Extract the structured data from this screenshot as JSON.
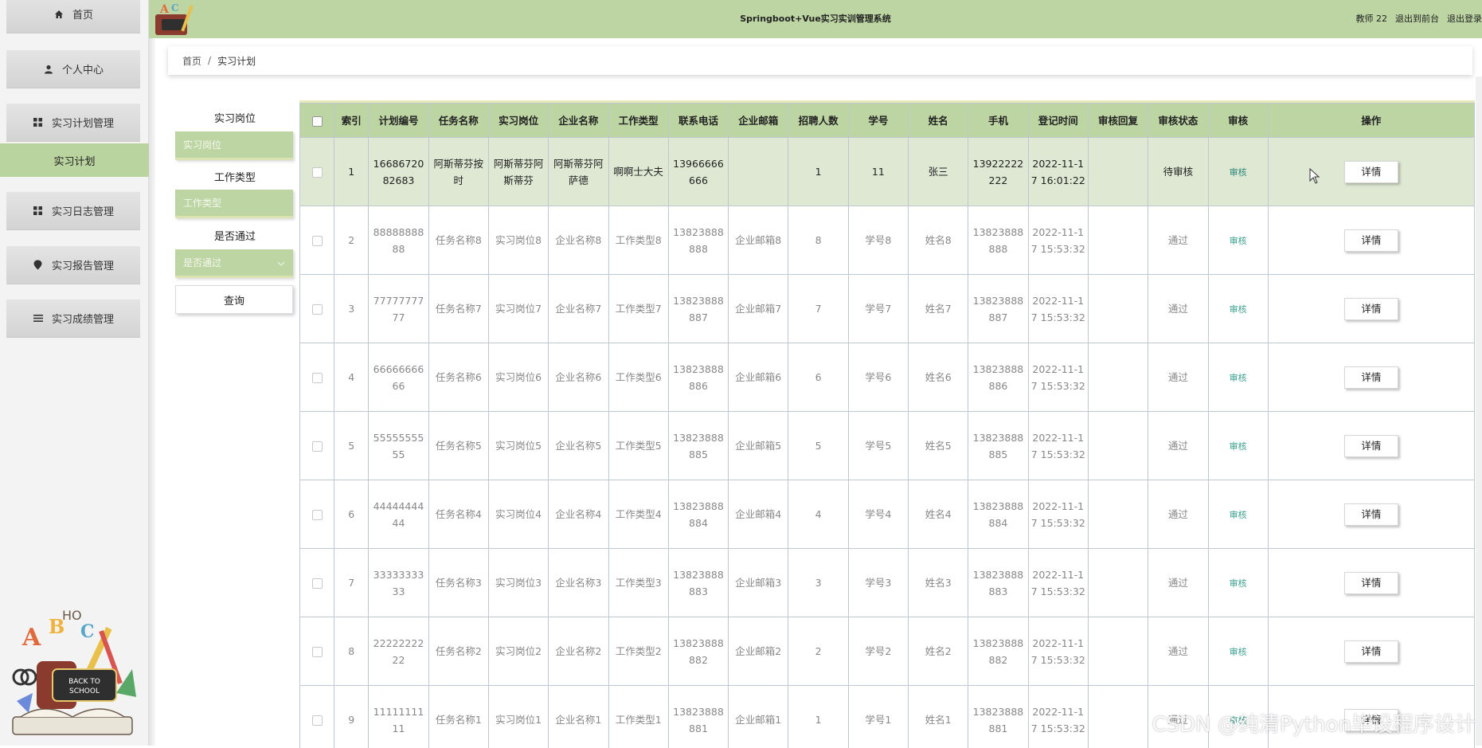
{
  "header": {
    "title": "Springboot+Vue实习实训管理系统",
    "user": "教师 22",
    "back_to_front": "退出到前台",
    "logout": "退出登录"
  },
  "sidebar": {
    "items": [
      {
        "label": "首页",
        "icon": "home-icon"
      },
      {
        "label": "个人中心",
        "icon": "user-icon"
      },
      {
        "label": "实习计划管理",
        "icon": "grid-icon"
      },
      {
        "label": "实习日志管理",
        "icon": "grid-icon"
      },
      {
        "label": "实习报告管理",
        "icon": "pin-icon"
      },
      {
        "label": "实习成绩管理",
        "icon": "list-icon"
      }
    ],
    "active_sub": "实习计划",
    "art_text": "BACK TO SCHOOL"
  },
  "breadcrumb": {
    "home": "首页",
    "sep": "/",
    "current": "实习计划"
  },
  "search": {
    "position_label": "实习岗位",
    "position_placeholder": "实习岗位",
    "job_type_label": "工作类型",
    "job_type_placeholder": "工作类型",
    "passed_label": "是否通过",
    "passed_placeholder": "是否通过",
    "query_button": "查询"
  },
  "table": {
    "headers": [
      "索引",
      "计划编号",
      "任务名称",
      "实习岗位",
      "企业名称",
      "工作类型",
      "联系电话",
      "企业邮箱",
      "招聘人数",
      "学号",
      "姓名",
      "手机",
      "登记时间",
      "审核回复",
      "审核状态",
      "审核",
      "操作"
    ],
    "review_link": "审核",
    "detail_button": "详情",
    "rows": [
      {
        "idx": "1",
        "plan": "1668672082683",
        "task": "阿斯蒂芬按时",
        "post": "阿斯蒂芬阿斯蒂芬",
        "company": "阿斯蒂芬阿萨德",
        "type": "啊啊士大夫",
        "phone": "13966666666",
        "email": "",
        "count": "1",
        "sid": "11",
        "name": "张三",
        "mobile": "13922222222",
        "time": "2022-11-17 16:01:22",
        "reply": "",
        "status": "待审核"
      },
      {
        "idx": "2",
        "plan": "8888888888",
        "task": "任务名称8",
        "post": "实习岗位8",
        "company": "企业名称8",
        "type": "工作类型8",
        "phone": "13823888888",
        "email": "企业邮箱8",
        "count": "8",
        "sid": "学号8",
        "name": "姓名8",
        "mobile": "13823888888",
        "time": "2022-11-17 15:53:32",
        "reply": "",
        "status": "通过"
      },
      {
        "idx": "3",
        "plan": "7777777777",
        "task": "任务名称7",
        "post": "实习岗位7",
        "company": "企业名称7",
        "type": "工作类型7",
        "phone": "13823888887",
        "email": "企业邮箱7",
        "count": "7",
        "sid": "学号7",
        "name": "姓名7",
        "mobile": "13823888887",
        "time": "2022-11-17 15:53:32",
        "reply": "",
        "status": "通过"
      },
      {
        "idx": "4",
        "plan": "6666666666",
        "task": "任务名称6",
        "post": "实习岗位6",
        "company": "企业名称6",
        "type": "工作类型6",
        "phone": "13823888886",
        "email": "企业邮箱6",
        "count": "6",
        "sid": "学号6",
        "name": "姓名6",
        "mobile": "13823888886",
        "time": "2022-11-17 15:53:32",
        "reply": "",
        "status": "通过"
      },
      {
        "idx": "5",
        "plan": "5555555555",
        "task": "任务名称5",
        "post": "实习岗位5",
        "company": "企业名称5",
        "type": "工作类型5",
        "phone": "13823888885",
        "email": "企业邮箱5",
        "count": "5",
        "sid": "学号5",
        "name": "姓名5",
        "mobile": "13823888885",
        "time": "2022-11-17 15:53:32",
        "reply": "",
        "status": "通过"
      },
      {
        "idx": "6",
        "plan": "4444444444",
        "task": "任务名称4",
        "post": "实习岗位4",
        "company": "企业名称4",
        "type": "工作类型4",
        "phone": "13823888884",
        "email": "企业邮箱4",
        "count": "4",
        "sid": "学号4",
        "name": "姓名4",
        "mobile": "13823888884",
        "time": "2022-11-17 15:53:32",
        "reply": "",
        "status": "通过"
      },
      {
        "idx": "7",
        "plan": "3333333333",
        "task": "任务名称3",
        "post": "实习岗位3",
        "company": "企业名称3",
        "type": "工作类型3",
        "phone": "13823888883",
        "email": "企业邮箱3",
        "count": "3",
        "sid": "学号3",
        "name": "姓名3",
        "mobile": "13823888883",
        "time": "2022-11-17 15:53:32",
        "reply": "",
        "status": "通过"
      },
      {
        "idx": "8",
        "plan": "2222222222",
        "task": "任务名称2",
        "post": "实习岗位2",
        "company": "企业名称2",
        "type": "工作类型2",
        "phone": "13823888882",
        "email": "企业邮箱2",
        "count": "2",
        "sid": "学号2",
        "name": "姓名2",
        "mobile": "13823888882",
        "time": "2022-11-17 15:53:32",
        "reply": "",
        "status": "通过"
      },
      {
        "idx": "9",
        "plan": "1111111111",
        "task": "任务名称1",
        "post": "实习岗位1",
        "company": "企业名称1",
        "type": "工作类型1",
        "phone": "13823888881",
        "email": "企业邮箱1",
        "count": "1",
        "sid": "学号1",
        "name": "姓名1",
        "mobile": "13823888881",
        "time": "2022-11-17 15:53:32",
        "reply": "",
        "status": "通过"
      }
    ]
  },
  "watermark": "CSDN @纯清Python毕设程序设计",
  "colors": {
    "accent": "#bdd5a2",
    "highlight_row": "#dfe8d3",
    "link": "#3aa08f"
  }
}
